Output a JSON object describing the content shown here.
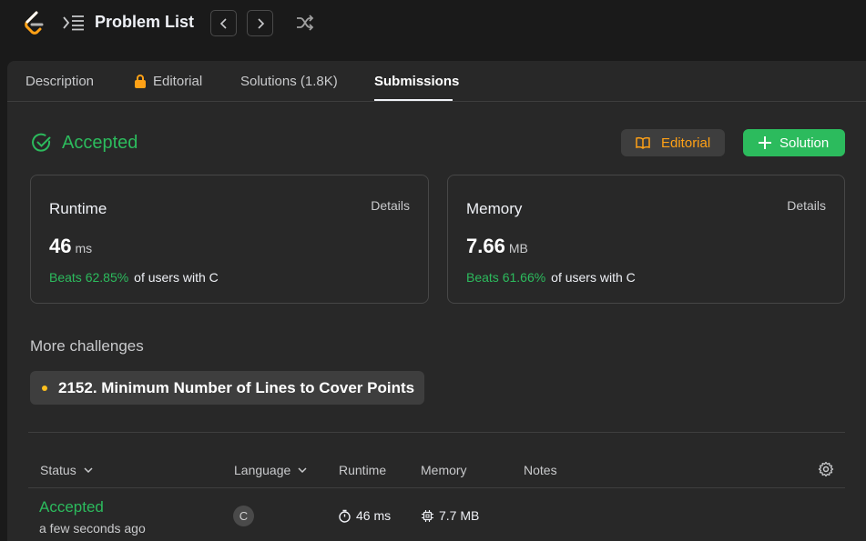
{
  "nav": {
    "title": "Problem List",
    "prev_icon": "chevron-left-icon",
    "next_icon": "chevron-right-icon",
    "shuffle_icon": "shuffle-icon"
  },
  "tabs": [
    {
      "label": "Description"
    },
    {
      "label": "Editorial",
      "icon": "lock-icon"
    },
    {
      "label": "Solutions (1.8K)"
    },
    {
      "label": "Submissions",
      "active": true
    }
  ],
  "result": {
    "status": "Accepted",
    "editorial_label": "Editorial",
    "solution_label": "Solution"
  },
  "runtime": {
    "title": "Runtime",
    "details": "Details",
    "value": "46",
    "unit": "ms",
    "beats": "Beats 62.85%",
    "users": "of users with C"
  },
  "memory": {
    "title": "Memory",
    "details": "Details",
    "value": "7.66",
    "unit": "MB",
    "beats": "Beats 61.66%",
    "users": "of users with C"
  },
  "more": {
    "title": "More challenges",
    "challenge": "2152. Minimum Number of Lines to Cover Points"
  },
  "table": {
    "headers": {
      "status": "Status",
      "language": "Language",
      "runtime": "Runtime",
      "memory": "Memory",
      "notes": "Notes"
    },
    "rows": [
      {
        "status": "Accepted",
        "time": "a few seconds ago",
        "language": "C",
        "runtime": "46 ms",
        "memory": "7.7 MB"
      }
    ]
  },
  "colors": {
    "accent_green": "#2cbb5d",
    "accent_orange": "#ffa116",
    "background": "#1a1a1a",
    "panel": "#282828"
  }
}
